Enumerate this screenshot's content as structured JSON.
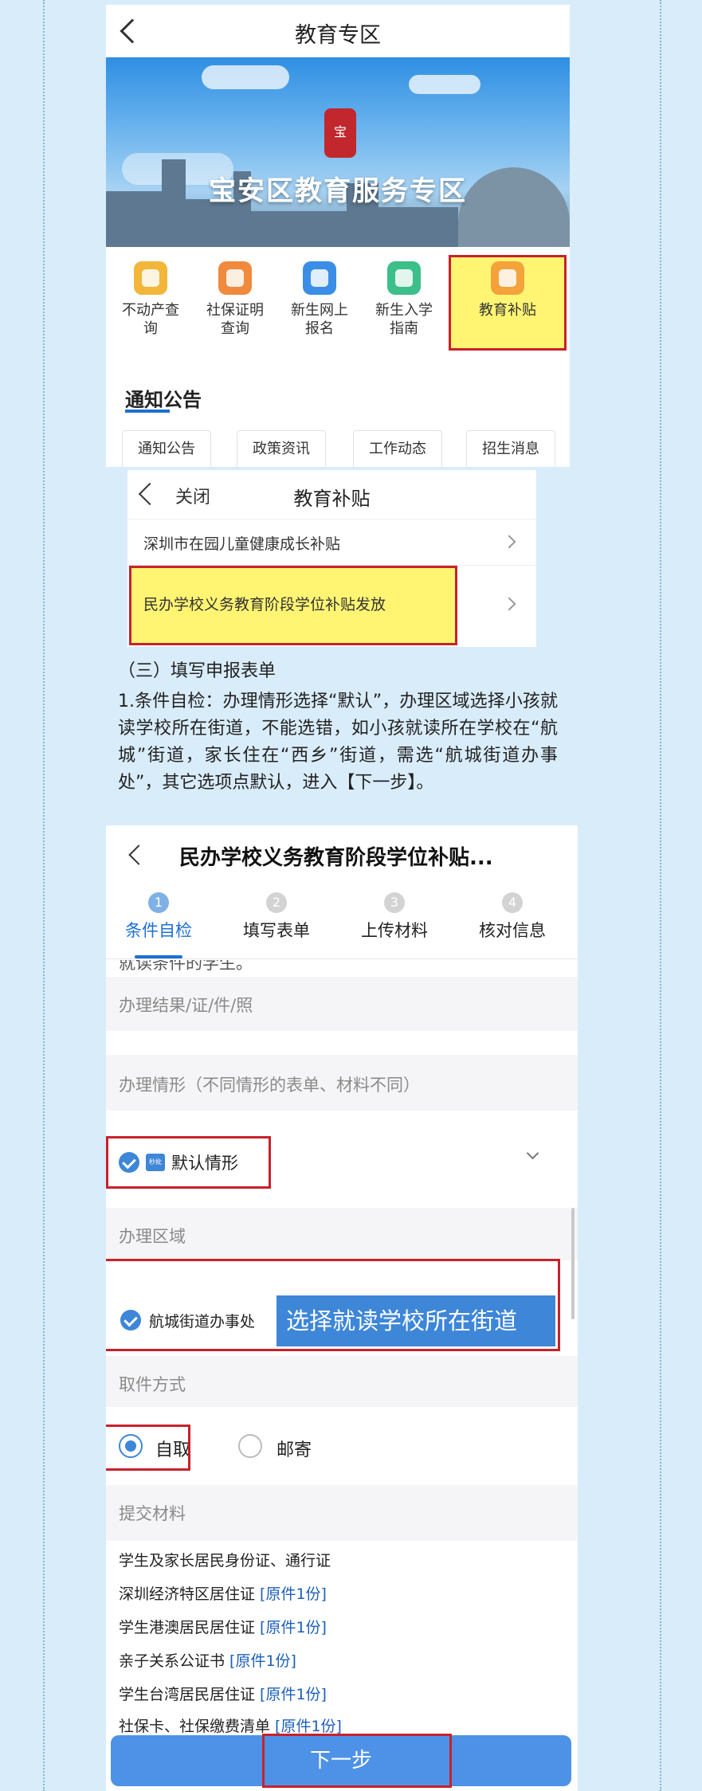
{
  "screen1": {
    "nav_title": "教育专区",
    "banner_title": "宝安区教育服务专区",
    "shortcuts": [
      {
        "label": "不动产查询",
        "icon": "house-icon",
        "color": "#f2b63a"
      },
      {
        "label": "社保证明查询",
        "icon": "shield-icon",
        "color": "#f08a3c"
      },
      {
        "label": "新生网上报名",
        "icon": "user-card-icon",
        "color": "#3a8ee6"
      },
      {
        "label": "新生入学指南",
        "icon": "clipboard-icon",
        "color": "#3cbf8a"
      },
      {
        "label": "教育补贴",
        "icon": "subsidy-icon",
        "color": "#f4a23a"
      }
    ],
    "shortcut_lines": [
      [
        "不动产查",
        "询"
      ],
      [
        "社保证明",
        "查询"
      ],
      [
        "新生网上",
        "报名"
      ],
      [
        "新生入学",
        "指南"
      ],
      [
        "教育补贴",
        ""
      ]
    ],
    "notice_title": "通知公告",
    "notice_tabs": [
      "通知公告",
      "政策资讯",
      "工作动态",
      "招生消息"
    ]
  },
  "screen2": {
    "close_label": "关闭",
    "nav_title": "教育补贴",
    "items": [
      "深圳市在园儿童健康成长补贴",
      "民办学校义务教育阶段学位补贴发放"
    ]
  },
  "instructions": {
    "heading": "（三）填写申报表单",
    "body": "1.条件自检：办理情形选择“默认”，办理区域选择小孩就读学校所在街道，不能选错，如小孩就读所在学校在“航城”街道，家长住在“西乡”街道，需选“航城街道办事处”，其它选项点默认，进入【下一步】。"
  },
  "screen3": {
    "nav_title": "民办学校义务教育阶段学位补贴...",
    "steps": [
      {
        "num": "1",
        "label": "条件自检"
      },
      {
        "num": "2",
        "label": "填写表单"
      },
      {
        "num": "3",
        "label": "上传材料"
      },
      {
        "num": "4",
        "label": "核对信息"
      }
    ],
    "cut_text": "就读条件的学生。",
    "result_label": "办理结果/证/件/照",
    "situation_label": "办理情形（不同情形的表单、材料不同）",
    "situation_tag": "秒批",
    "situation_value": "默认情形",
    "area_label": "办理区域",
    "area_value": "航城街道办事处",
    "area_callout": "选择就读学校所在街道",
    "pickup_label": "取件方式",
    "pickup_options": [
      "自取",
      "邮寄"
    ],
    "materials_label": "提交材料",
    "materials": [
      {
        "name": "学生及家长居民身份证、通行证",
        "copies": ""
      },
      {
        "name": "深圳经济特区居住证 ",
        "copies": "[原件1份]"
      },
      {
        "name": "学生港澳居民居住证 ",
        "copies": "[原件1份]"
      },
      {
        "name": "亲子关系公证书 ",
        "copies": "[原件1份]"
      },
      {
        "name": "学生台湾居民居住证 ",
        "copies": "[原件1份]"
      },
      {
        "name": "社保卡、社保缴费清单 ",
        "copies": "[原件1份]"
      }
    ],
    "next_button": "下一步"
  },
  "colors": {
    "highlight": "#fff028",
    "highlight_border": "#c8212b",
    "primary": "#3d86d8",
    "page_bg": "#d9ecfa"
  }
}
